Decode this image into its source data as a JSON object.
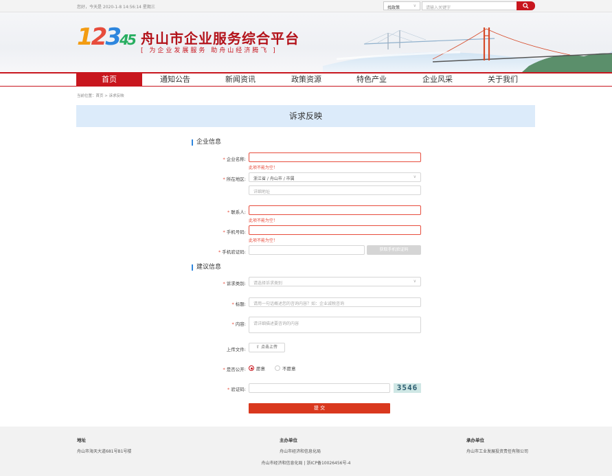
{
  "topbar": {
    "greeting": "您好，今天是 2020-1-8 14:56:14 星期三",
    "search_type": "找政策",
    "search_placeholder": "请输入关键字"
  },
  "banner": {
    "logo_digits": [
      "1",
      "2",
      "3",
      "4",
      "5"
    ],
    "title": "舟山市企业服务综合平台",
    "slogan": "[ 为企业发展服务    助舟山经济腾飞 ]"
  },
  "nav": {
    "items": [
      {
        "label": "首页",
        "active": true
      },
      {
        "label": "通知公告"
      },
      {
        "label": "新闻资讯"
      },
      {
        "label": "政策资源"
      },
      {
        "label": "特色产业"
      },
      {
        "label": "企业风采"
      },
      {
        "label": "关于我们"
      }
    ]
  },
  "breadcrumb": "当前位置：首页 > 诉求反映",
  "page_title": "诉求反映",
  "sections": {
    "company": "企业信息",
    "suggest": "建议信息"
  },
  "form": {
    "company_name": {
      "label": "企业名称:",
      "error": "此项不能为空！"
    },
    "region": {
      "label": "所在地区:",
      "value": "浙江省 / 舟山市 / 市属",
      "detail_placeholder": "详细地址"
    },
    "contact": {
      "label": "联系人:",
      "error": "此项不能为空！"
    },
    "phone": {
      "label": "手机号码:",
      "error": "此项不能为空！"
    },
    "sms_code": {
      "label": "手机验证码:",
      "button": "获取手机验证码"
    },
    "category": {
      "label": "诉求类别:",
      "placeholder": "请选择诉求类别"
    },
    "subject": {
      "label": "标题:",
      "placeholder": "请用一句话概述您的咨询内容？如：企业减税咨询"
    },
    "content": {
      "label": "内容:",
      "placeholder": "请详细描述要咨询的内容"
    },
    "upload": {
      "label": "上传文件:",
      "button": "点击上传"
    },
    "public": {
      "label": "是否公开:",
      "options": [
        "愿意",
        "不愿意"
      ],
      "selected": "愿意"
    },
    "captcha": {
      "label": "验证码:",
      "code": "3546"
    },
    "submit": "提 交"
  },
  "footer": {
    "address_title": "地址",
    "address": "舟山市海天大道681号B1号楼",
    "host_title": "主办单位",
    "host": "舟山市经济和信息化局",
    "undertake_title": "承办单位",
    "undertake": "舟山市工业发展投资责任有限公司",
    "bottom": "舟山市经济和信息化局 | 浙ICP备10026456号-4"
  },
  "colors": {
    "brand_red": "#c8161e",
    "title_band": "#dcebfa",
    "accent_blue": "#2e86de",
    "submit": "#d9381e"
  }
}
